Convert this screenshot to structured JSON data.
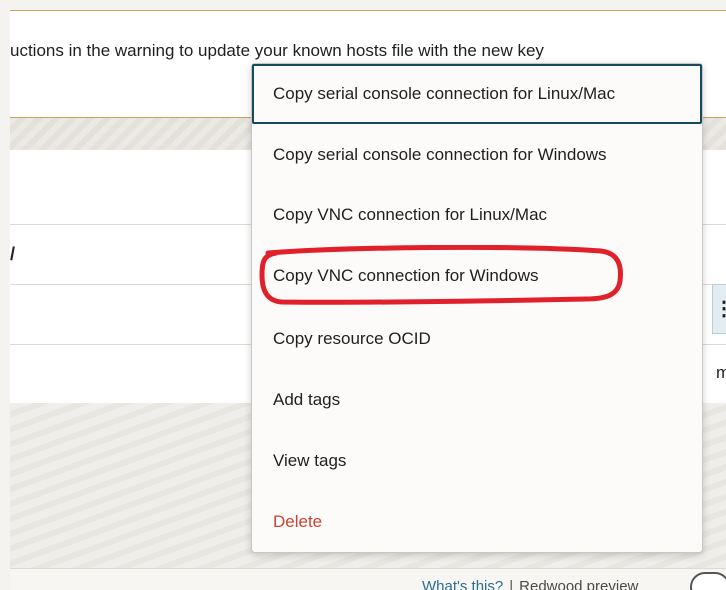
{
  "warning": {
    "text": "uctions in the warning to update your known hosts file with the new key"
  },
  "panel": {
    "row_letter": "/",
    "kebab_label": "⋮",
    "trailing_text": "m"
  },
  "context_menu": {
    "items": [
      {
        "label": "Copy serial console connection for Linux/Mac"
      },
      {
        "label": "Copy serial console connection for Windows"
      },
      {
        "label": "Copy VNC connection for Linux/Mac"
      },
      {
        "label": "Copy VNC connection for Windows"
      },
      {
        "label": "Copy resource OCID"
      },
      {
        "label": "Add tags"
      },
      {
        "label": "View tags"
      },
      {
        "label": "Delete"
      }
    ]
  },
  "footer": {
    "whats_this": "What's this?",
    "separator": "|",
    "redwood_preview": "Redwood preview"
  },
  "colors": {
    "accent": "#174a5e",
    "danger": "#c74634",
    "annotation": "#e0202a",
    "link": "#2b6e8f"
  }
}
